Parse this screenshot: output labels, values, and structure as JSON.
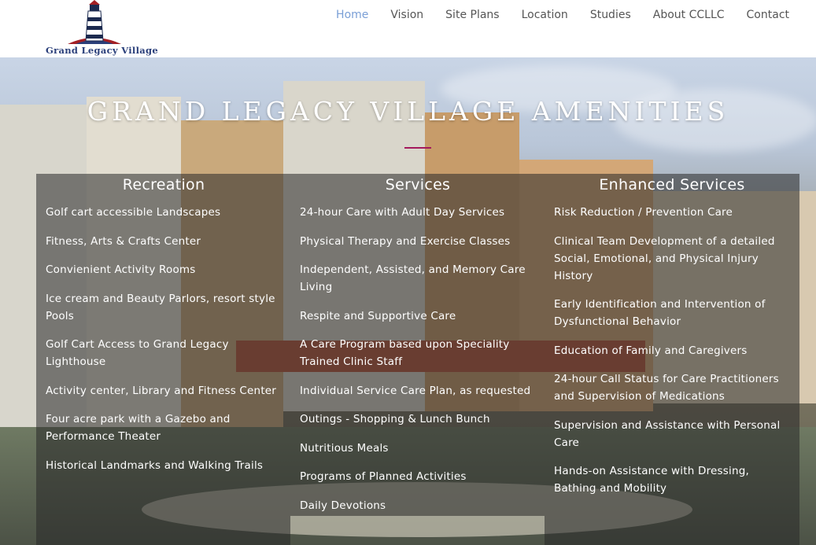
{
  "brand": {
    "name": "Grand Legacy Village"
  },
  "nav": {
    "items": [
      {
        "label": "Home",
        "active": true
      },
      {
        "label": "Vision",
        "active": false
      },
      {
        "label": "Site Plans",
        "active": false
      },
      {
        "label": "Location",
        "active": false
      },
      {
        "label": "Studies",
        "active": false
      },
      {
        "label": "About CCLLC",
        "active": false
      },
      {
        "label": "Contact",
        "active": false
      }
    ]
  },
  "hero": {
    "title": "GRAND LEGACY VILLAGE AMENITIES"
  },
  "columns": [
    {
      "heading": "Recreation",
      "items": [
        "Golf cart accessible Landscapes",
        "Fitness, Arts & Crafts Center",
        "Convienient Activity Rooms",
        "Ice cream and Beauty Parlors, resort style Pools",
        "Golf Cart Access to Grand Legacy Lighthouse",
        "Activity center, Library and Fitness Center",
        "Four acre park with a Gazebo and Performance Theater",
        "Historical Landmarks and Walking Trails"
      ]
    },
    {
      "heading": "Services",
      "items": [
        "24-hour Care with Adult Day Services",
        "Physical Therapy and Exercise Classes",
        "Independent, Assisted, and Memory Care Living",
        "Respite and Supportive Care",
        "A Care Program based upon Speciality Trained Clinic Staff",
        "Individual Service Care Plan, as requested",
        "Outings - Shopping & Lunch Bunch",
        "Nutritious Meals",
        "Programs of Planned Activities",
        "Daily Devotions"
      ]
    },
    {
      "heading": "Enhanced Services",
      "items": [
        "Risk Reduction / Prevention Care",
        "Clinical Team Development of a detailed Social, Emotional, and Physical Injury History",
        "Early Identification and Intervention of Dysfunctional Behavior",
        "Education of Family and Caregivers",
        "24-hour Call Status for Care Practitioners and Supervision of Medications",
        "Supervision and Assistance with Personal Care",
        "Hands-on Assistance with Dressing, Bathing and Mobility"
      ]
    }
  ],
  "colors": {
    "nav_active": "#7a9fd6",
    "nav_text": "#555555",
    "brand_text": "#2a3f7a",
    "divider": "#a4195c"
  }
}
